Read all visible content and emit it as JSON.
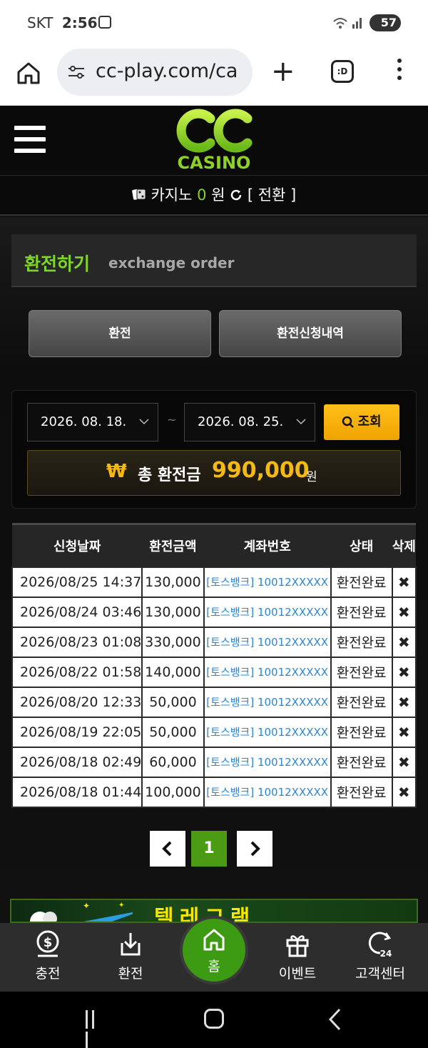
{
  "status_bar": {
    "carrier": "SKT",
    "time": "2:56",
    "battery": "57"
  },
  "browser": {
    "url": "cc-play.com/ca",
    "tab_label": ":D"
  },
  "site": {
    "logo_text": "CASINO"
  },
  "balance": {
    "label": "카지노",
    "amount": "0",
    "unit": "원",
    "convert_label": "[ 전환 ]"
  },
  "section": {
    "title": "환전하기",
    "subtitle": "exchange order"
  },
  "tabs": [
    {
      "label": "환전"
    },
    {
      "label": "환전신청내역"
    }
  ],
  "search": {
    "date_from": "2026. 08. 18.",
    "separator": "~",
    "date_to": "2026. 08. 25.",
    "button_label": "조회"
  },
  "total": {
    "currency_symbol": "₩",
    "label": "총 환전금",
    "amount": "990,000",
    "unit": "원"
  },
  "table": {
    "headers": [
      "신청날짜",
      "환전금액",
      "계좌번호",
      "상태",
      "삭제"
    ],
    "rows": [
      {
        "date": "2026/08/25 14:37",
        "amount": "130,000",
        "account": "[토스뱅크] 10012XXXXX",
        "status": "환전완료",
        "delete": "✖"
      },
      {
        "date": "2026/08/24 03:46",
        "amount": "130,000",
        "account": "[토스뱅크] 10012XXXXX",
        "status": "환전완료",
        "delete": "✖"
      },
      {
        "date": "2026/08/23 01:08",
        "amount": "330,000",
        "account": "[토스뱅크] 10012XXXXX",
        "status": "환전완료",
        "delete": "✖"
      },
      {
        "date": "2026/08/22 01:58",
        "amount": "140,000",
        "account": "[토스뱅크] 10012XXXXX",
        "status": "환전완료",
        "delete": "✖"
      },
      {
        "date": "2026/08/20 12:33",
        "amount": "50,000",
        "account": "[토스뱅크] 10012XXXXX",
        "status": "환전완료",
        "delete": "✖"
      },
      {
        "date": "2026/08/19 22:05",
        "amount": "50,000",
        "account": "[토스뱅크] 10012XXXXX",
        "status": "환전완료",
        "delete": "✖"
      },
      {
        "date": "2026/08/18 02:49",
        "amount": "60,000",
        "account": "[토스뱅크] 10012XXXXX",
        "status": "환전완료",
        "delete": "✖"
      },
      {
        "date": "2026/08/18 01:44",
        "amount": "100,000",
        "account": "[토스뱅크] 10012XXXXX",
        "status": "환전완료",
        "delete": "✖"
      }
    ]
  },
  "pagination": {
    "prev": "‹",
    "current": "1",
    "next": "›"
  },
  "banner": {
    "text": "텔레그램"
  },
  "bottom_nav": [
    {
      "label": "충전",
      "icon": "dollar-coin-icon"
    },
    {
      "label": "환전",
      "icon": "download-tray-icon"
    },
    {
      "label": "홈",
      "icon": "home-icon"
    },
    {
      "label": "이벤트",
      "icon": "gift-icon"
    },
    {
      "label": "고객센터",
      "icon": "support-24-icon"
    }
  ],
  "colors": {
    "accent_green": "#7fd62a",
    "gold": "#f5b915",
    "link_blue": "#2a86d6"
  }
}
